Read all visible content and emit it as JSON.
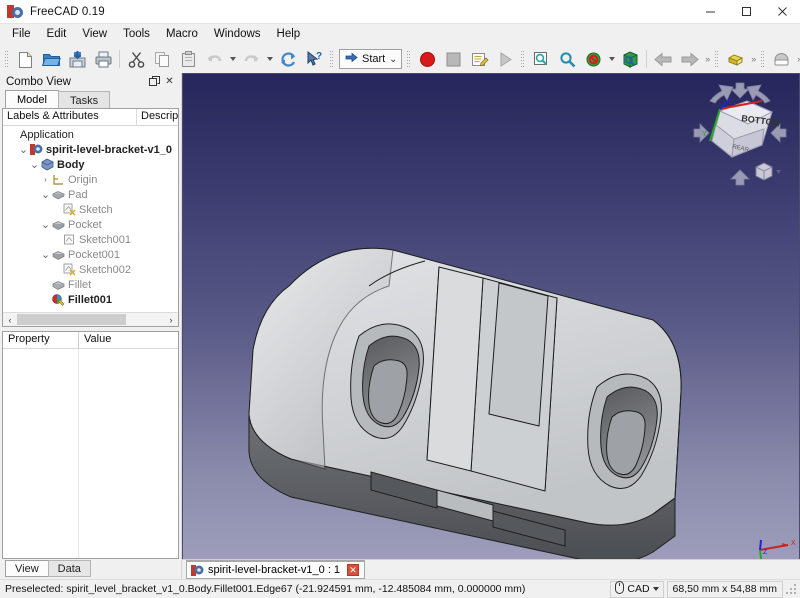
{
  "window": {
    "title": "FreeCAD 0.19",
    "app_icon": "freecad-logo-icon",
    "minimize_label": "–",
    "maximize_label": "□",
    "close_label": "✕"
  },
  "menubar": {
    "items": [
      {
        "label": "File"
      },
      {
        "label": "Edit"
      },
      {
        "label": "View"
      },
      {
        "label": "Tools"
      },
      {
        "label": "Macro"
      },
      {
        "label": "Windows"
      },
      {
        "label": "Help"
      }
    ]
  },
  "toolbar": {
    "file_group": [
      {
        "name": "new-document-icon",
        "label": "New"
      },
      {
        "name": "open-document-icon",
        "label": "Open"
      },
      {
        "name": "save-document-icon",
        "label": "Save"
      },
      {
        "name": "print-document-icon",
        "label": "Print"
      }
    ],
    "edit_group": [
      {
        "name": "cut-icon",
        "label": "Cut"
      },
      {
        "name": "copy-icon",
        "label": "Copy"
      },
      {
        "name": "paste-icon",
        "label": "Paste"
      },
      {
        "name": "undo-icon",
        "label": "Undo"
      },
      {
        "name": "redo-icon",
        "label": "Redo"
      },
      {
        "name": "refresh-icon",
        "label": "Refresh"
      },
      {
        "name": "whats-this-icon",
        "label": "What's This"
      }
    ],
    "workbench": {
      "selected": "Start",
      "icon": "blue-arrow-icon",
      "chevron": "⌄"
    },
    "macro_group": [
      {
        "name": "macro-record-icon",
        "label": "Macro recording"
      },
      {
        "name": "macro-stop-icon",
        "label": "Stop macro recording"
      },
      {
        "name": "macros-icon",
        "label": "Macros"
      },
      {
        "name": "execute-macro-icon",
        "label": "Execute macro"
      }
    ],
    "view_group": [
      {
        "name": "fit-all-icon",
        "label": "Fit all"
      },
      {
        "name": "zoom-box-icon",
        "label": "Fit selection"
      },
      {
        "name": "draw-style-icon",
        "label": "Draw style"
      },
      {
        "name": "axonometric-view-icon",
        "label": "Axonometric"
      },
      {
        "name": "back-arrow-icon",
        "label": "Previous view"
      },
      {
        "name": "forward-arrow-icon",
        "label": "Next view"
      }
    ],
    "extra_group": [
      {
        "name": "create-part-icon",
        "label": "Create part"
      },
      {
        "name": "create-group-icon",
        "label": "Create group"
      }
    ],
    "overflow_label": "»"
  },
  "combo_view": {
    "title": "Combo View",
    "float_label": "❐",
    "close_label": "✕",
    "tabs": [
      {
        "label": "Model",
        "active": true
      },
      {
        "label": "Tasks",
        "active": false
      }
    ],
    "tree_headers": {
      "labels": "Labels & Attributes",
      "description": "Descrip"
    },
    "tree": [
      {
        "label": "Application",
        "indent": 0,
        "twist": "",
        "icon": "",
        "bold": false,
        "dim": false
      },
      {
        "label": "spirit-level-bracket-v1_0",
        "indent": 1,
        "twist": "⌄",
        "icon": "document-icon",
        "bold": true,
        "dim": false
      },
      {
        "label": "Body",
        "indent": 2,
        "twist": "⌄",
        "icon": "body-icon",
        "bold": true,
        "dim": false
      },
      {
        "label": "Origin",
        "indent": 3,
        "twist": "›",
        "icon": "origin-icon",
        "bold": false,
        "dim": true
      },
      {
        "label": "Pad",
        "indent": 3,
        "twist": "⌄",
        "icon": "pad-icon",
        "bold": false,
        "dim": true
      },
      {
        "label": "Sketch",
        "indent": 4,
        "twist": "",
        "icon": "sketch-icon",
        "bold": false,
        "dim": true
      },
      {
        "label": "Pocket",
        "indent": 3,
        "twist": "⌄",
        "icon": "pocket-icon",
        "bold": false,
        "dim": true
      },
      {
        "label": "Sketch001",
        "indent": 4,
        "twist": "",
        "icon": "sketch-plain-icon",
        "bold": false,
        "dim": true
      },
      {
        "label": "Pocket001",
        "indent": 3,
        "twist": "⌄",
        "icon": "pocket-icon",
        "bold": false,
        "dim": true
      },
      {
        "label": "Sketch002",
        "indent": 4,
        "twist": "",
        "icon": "sketch-icon",
        "bold": false,
        "dim": true
      },
      {
        "label": "Fillet",
        "indent": 3,
        "twist": "",
        "icon": "fillet-icon",
        "bold": false,
        "dim": true
      },
      {
        "label": "Fillet001",
        "indent": 3,
        "twist": "",
        "icon": "fillet-active-icon",
        "bold": true,
        "dim": false
      }
    ],
    "property_headers": {
      "property": "Property",
      "value": "Value"
    },
    "property_rows": [],
    "bottom_tabs": [
      {
        "label": "View",
        "active": true
      },
      {
        "label": "Data",
        "active": false
      }
    ]
  },
  "view3d": {
    "nav_cube_face": "BOTTOM",
    "nav_cube_side": "REAR",
    "axis_labels": {
      "x": "X",
      "y": "Y",
      "z": "Z"
    },
    "axis_colors": {
      "x": "#cc2222",
      "y": "#22aa22",
      "z": "#2222cc"
    },
    "background": {
      "top": "#26265c",
      "bottom": "#9d9dbb"
    },
    "model_name": "spirit-level-bracket",
    "model_colors": {
      "light": "#d5d7d9",
      "mid": "#b9bcbe",
      "dark": "#5a5c5e",
      "edge": "#2a2a2a"
    }
  },
  "document_tab": {
    "label": "spirit-level-bracket-v1_0 : 1",
    "close_label": "✕",
    "icon": "freecad-document-icon"
  },
  "statusbar": {
    "message": "Preselected: spirit_level_bracket_v1_0.Body.Fillet001.Edge67 (-21.924591 mm, -12.485084 mm, 0.000000 mm)",
    "navigation_style": "CAD",
    "navigation_icon": "mouse-icon",
    "navigation_chevron": "▾",
    "dimensions": "68,50 mm x 54,88 mm"
  }
}
